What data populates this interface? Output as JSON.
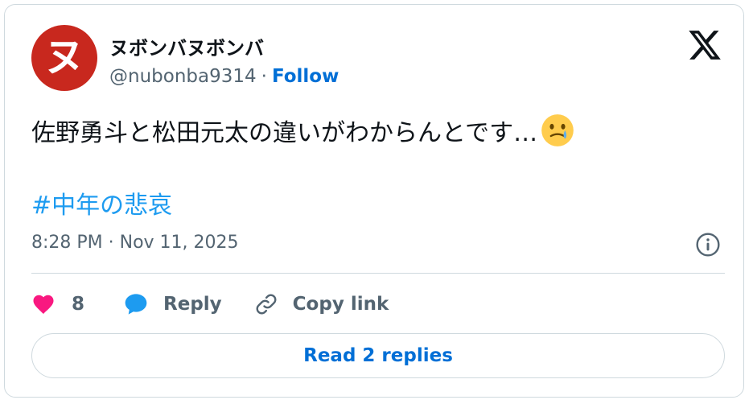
{
  "author": {
    "display_name": "ヌボンバヌボンバ",
    "handle": "@nubonba9314",
    "separator": "·",
    "follow_label": "Follow",
    "avatar_glyph": "ヌ",
    "avatar_color": "#c8281e"
  },
  "tweet": {
    "text": "佐野勇斗と松田元太の違いがわからんとです…",
    "emoji": "face-holding-back-tears",
    "hashtag": "#中年の悲哀",
    "timestamp": "8:28 PM · Nov 11, 2025"
  },
  "actions": {
    "like_count": "8",
    "reply_label": "Reply",
    "copy_link_label": "Copy link"
  },
  "replies_button": {
    "label": "Read 2 replies"
  },
  "colors": {
    "accent": "#006fd6",
    "hashtag": "#1d9bf0",
    "like": "#f91880",
    "reply_icon": "#1d9bf0",
    "muted": "#536471",
    "border": "#cfd9de"
  },
  "icons": [
    "x-logo-icon",
    "info-icon",
    "heart-icon",
    "speech-bubble-icon",
    "link-icon",
    "tear-face-emoji-icon"
  ]
}
